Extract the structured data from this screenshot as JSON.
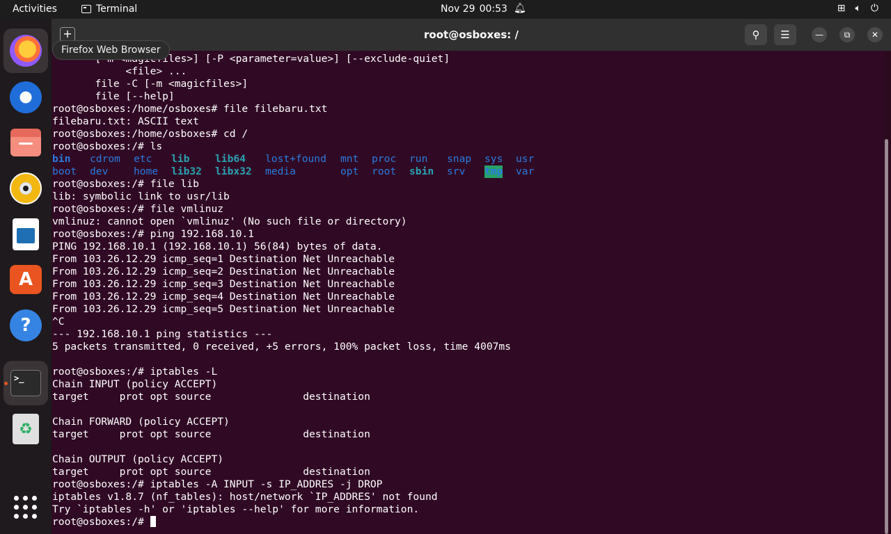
{
  "topbar": {
    "activities": "Activities",
    "app_name": "Terminal",
    "date": "Nov 29",
    "time": "00:53",
    "bell_icon": "bell-icon",
    "tray_icons": [
      "network-icon",
      "volume-icon",
      "power-icon"
    ]
  },
  "dock": {
    "items": [
      {
        "name": "firefox-icon"
      },
      {
        "name": "thunderbird-icon"
      },
      {
        "name": "files-icon"
      },
      {
        "name": "rhythmbox-icon"
      },
      {
        "name": "libreoffice-writer-icon"
      },
      {
        "name": "app-center-icon"
      },
      {
        "name": "help-icon"
      },
      {
        "name": "terminal-icon"
      },
      {
        "name": "trash-icon"
      }
    ],
    "tooltip": "Firefox Web Browser"
  },
  "window": {
    "title": "root@osboxes: /"
  },
  "terminal": {
    "lines": [
      "       [-m <magicfiles>] [-P <parameter=value>] [--exclude-quiet]",
      "            <file> ...",
      "       file -C [-m <magicfiles>]",
      "       file [--help]",
      "root@osboxes:/home/osboxes# file filebaru.txt",
      "filebaru.txt: ASCII text",
      "root@osboxes:/home/osboxes# cd /",
      "root@osboxes:/# ls"
    ],
    "ls_rows": [
      [
        {
          "t": "bin",
          "c": "b"
        },
        {
          "t": "cdrom",
          "c": "d"
        },
        {
          "t": "etc",
          "c": "d"
        },
        {
          "t": "lib",
          "c": "c"
        },
        {
          "t": "lib64",
          "c": "c"
        },
        {
          "t": "lost+found",
          "c": "d"
        },
        {
          "t": "mnt",
          "c": "d"
        },
        {
          "t": "proc",
          "c": "d"
        },
        {
          "t": "run",
          "c": "d"
        },
        {
          "t": "snap",
          "c": "d"
        },
        {
          "t": "sys",
          "c": "d"
        },
        {
          "t": "usr",
          "c": "d"
        }
      ],
      [
        {
          "t": "boot",
          "c": "d"
        },
        {
          "t": "dev",
          "c": "d"
        },
        {
          "t": "home",
          "c": "d"
        },
        {
          "t": "lib32",
          "c": "c"
        },
        {
          "t": "libx32",
          "c": "c"
        },
        {
          "t": "media",
          "c": "d"
        },
        {
          "t": "opt",
          "c": "d"
        },
        {
          "t": "root",
          "c": "d"
        },
        {
          "t": "sbin",
          "c": "c"
        },
        {
          "t": "srv",
          "c": "d"
        },
        {
          "t": "tmp",
          "c": "t"
        },
        {
          "t": "var",
          "c": "d"
        }
      ]
    ],
    "lines_after": [
      "root@osboxes:/# file lib",
      "lib: symbolic link to usr/lib",
      "root@osboxes:/# file vmlinuz",
      "vmlinuz: cannot open `vmlinuz' (No such file or directory)",
      "root@osboxes:/# ping 192.168.10.1",
      "PING 192.168.10.1 (192.168.10.1) 56(84) bytes of data.",
      "From 103.26.12.29 icmp_seq=1 Destination Net Unreachable",
      "From 103.26.12.29 icmp_seq=2 Destination Net Unreachable",
      "From 103.26.12.29 icmp_seq=3 Destination Net Unreachable",
      "From 103.26.12.29 icmp_seq=4 Destination Net Unreachable",
      "From 103.26.12.29 icmp_seq=5 Destination Net Unreachable",
      "^C",
      "--- 192.168.10.1 ping statistics ---",
      "5 packets transmitted, 0 received, +5 errors, 100% packet loss, time 4007ms",
      "",
      "root@osboxes:/# iptables -L",
      "Chain INPUT (policy ACCEPT)",
      "target     prot opt source               destination",
      "",
      "Chain FORWARD (policy ACCEPT)",
      "target     prot opt source               destination",
      "",
      "Chain OUTPUT (policy ACCEPT)",
      "target     prot opt source               destination",
      "root@osboxes:/# iptables -A INPUT -s IP_ADDRES -j DROP",
      "iptables v1.8.7 (nf_tables): host/network `IP_ADDRES' not found",
      "Try `iptables -h' or 'iptables --help' for more information.",
      "root@osboxes:/# "
    ],
    "colors": {
      "background": "#300a24",
      "text": "#ffffff",
      "dir": "#2a7bde",
      "link": "#2aa1b3",
      "tmp_bg": "#26a269"
    }
  }
}
